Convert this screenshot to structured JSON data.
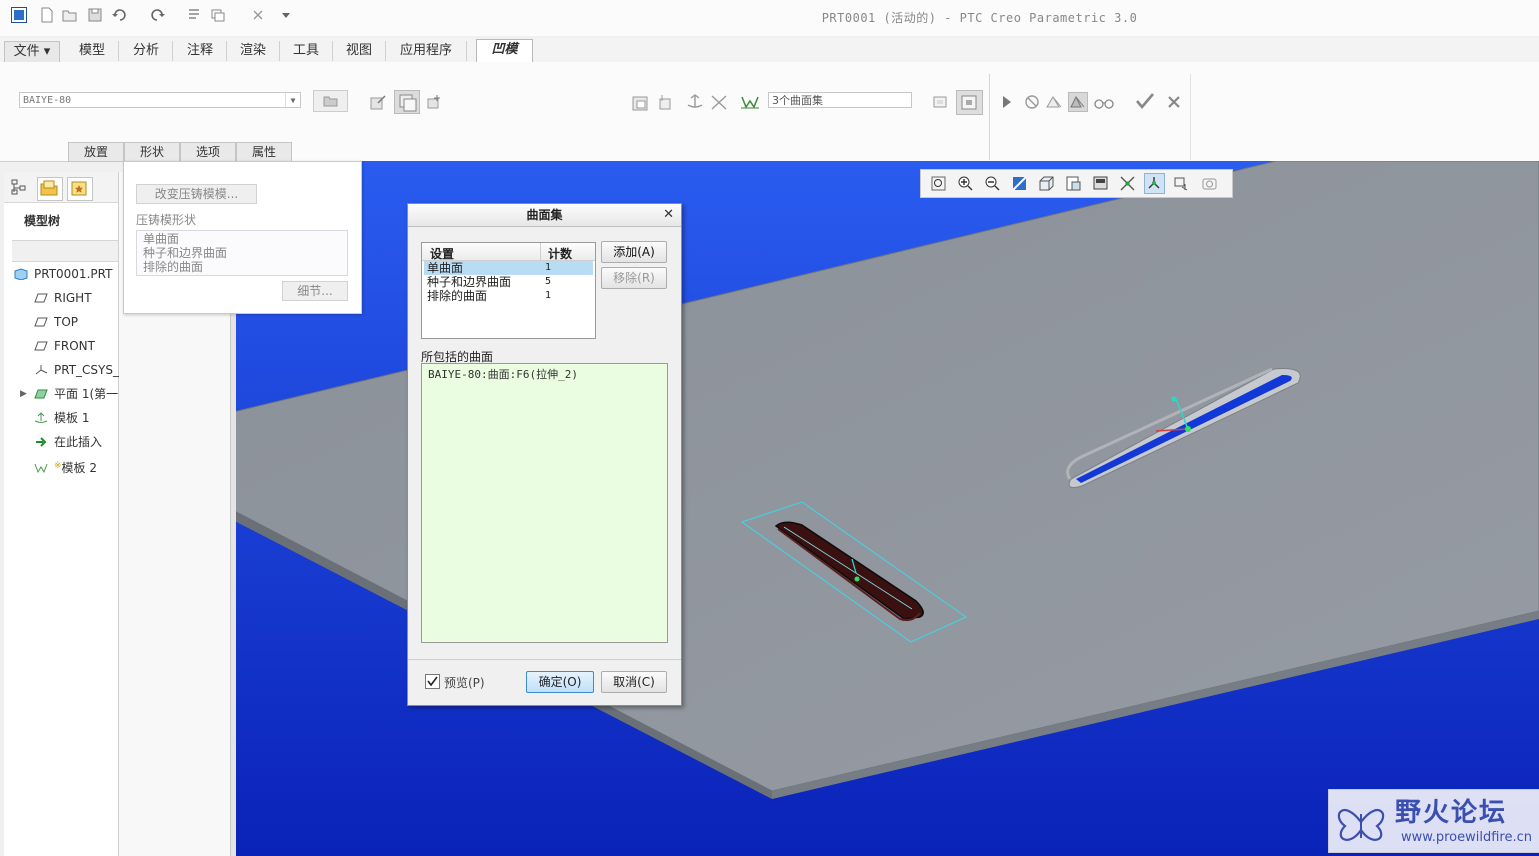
{
  "window": {
    "title": "PRT0001 (活动的) - PTC Creo Parametric 3.0"
  },
  "tabs": [
    {
      "label": "文件",
      "active": false
    },
    {
      "label": "模型",
      "active": false
    },
    {
      "label": "分析",
      "active": false
    },
    {
      "label": "注释",
      "active": false
    },
    {
      "label": "渲染",
      "active": false
    },
    {
      "label": "工具",
      "active": false
    },
    {
      "label": "视图",
      "active": false
    },
    {
      "label": "应用程序",
      "active": false
    },
    {
      "label": "凹模",
      "active": true
    }
  ],
  "ribbon": {
    "die_combo": "BAIYE-80",
    "surfset_field": "3个曲面集",
    "subtabs": [
      "放置",
      "形状",
      "选项",
      "属性"
    ]
  },
  "model_tree": {
    "title": "模型树",
    "items": [
      {
        "label": "PRT0001.PRT",
        "icon": "part-icon"
      },
      {
        "label": "RIGHT",
        "icon": "datum-plane-icon"
      },
      {
        "label": "TOP",
        "icon": "datum-plane-icon"
      },
      {
        "label": "FRONT",
        "icon": "datum-plane-icon"
      },
      {
        "label": "PRT_CSYS_",
        "icon": "csys-icon"
      },
      {
        "label": "平面 1(第一",
        "icon": "flat-wall-icon"
      },
      {
        "label": "模板 1",
        "icon": "punch-form-icon"
      },
      {
        "label": "在此插入",
        "icon": "insert-here-icon"
      },
      {
        "label": "模板 2",
        "icon": "die-form-icon"
      }
    ]
  },
  "placement_panel": {
    "change_button": "改变压铸模模...",
    "shape_label": "压铸模形状",
    "shape_items": [
      "单曲面",
      "种子和边界曲面",
      "排除的曲面"
    ],
    "details_button": "细节..."
  },
  "surfset_dialog": {
    "title": "曲面集",
    "columns": [
      "设置",
      "计数"
    ],
    "rows": [
      {
        "name": "单曲面",
        "count": "1",
        "selected": true
      },
      {
        "name": "种子和边界曲面",
        "count": "5",
        "selected": false
      },
      {
        "name": "排除的曲面",
        "count": "1",
        "selected": false
      }
    ],
    "add_button": "添加(A)",
    "remove_button": "移除(R)",
    "included_label": "所包括的曲面",
    "included_items": [
      "BAIYE-80:曲面:F6(拉伸_2)"
    ],
    "preview_label": "预览(P)",
    "preview_checked": true,
    "ok_button": "确定(O)",
    "cancel_button": "取消(C)"
  },
  "watermark": {
    "title": "野火论坛",
    "url": "www.proewildfire.cn"
  },
  "colors": {
    "viewport_top": "#2a5cf0",
    "viewport_bottom": "#0a22b8",
    "plate": "#8e949c",
    "die": "#3d1212",
    "accent": "#2060c0"
  }
}
